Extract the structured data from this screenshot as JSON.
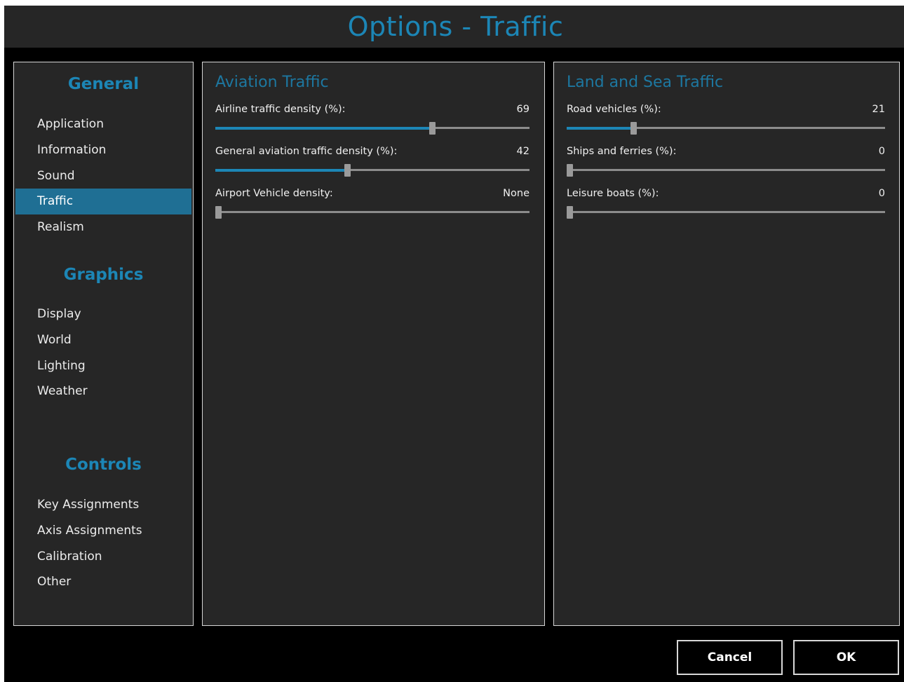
{
  "window": {
    "title": "Options - Traffic"
  },
  "sidebar": {
    "sections": [
      {
        "heading": "General",
        "items": [
          "Application",
          "Information",
          "Sound",
          "Traffic",
          "Realism"
        ]
      },
      {
        "heading": "Graphics",
        "items": [
          "Display",
          "World",
          "Lighting",
          "Weather"
        ]
      },
      {
        "heading": "Controls",
        "items": [
          "Key Assignments",
          "Axis Assignments",
          "Calibration",
          "Other"
        ]
      }
    ],
    "active_item": "Traffic"
  },
  "aviation": {
    "title": "Aviation Traffic",
    "settings": [
      {
        "label": "Airline traffic density (%):",
        "value": "69",
        "level_percent": 69
      },
      {
        "label": "General aviation traffic density (%):",
        "value": "42",
        "level_percent": 42
      },
      {
        "label": "Airport Vehicle density:",
        "value": "None",
        "level_percent": 0
      }
    ]
  },
  "land_sea": {
    "title": "Land and Sea Traffic",
    "settings": [
      {
        "label": "Road vehicles (%):",
        "value": "21",
        "level_percent": 21
      },
      {
        "label": "Ships and ferries (%):",
        "value": "0",
        "level_percent": 0
      },
      {
        "label": "Leisure boats (%):",
        "value": "0",
        "level_percent": 0
      }
    ]
  },
  "buttons": {
    "cancel": "Cancel",
    "ok": "OK"
  },
  "colors": {
    "accent": "#1c86b6",
    "active_nav": "#1f6f94",
    "panel_bg": "#262626",
    "window_bg": "#000000"
  }
}
